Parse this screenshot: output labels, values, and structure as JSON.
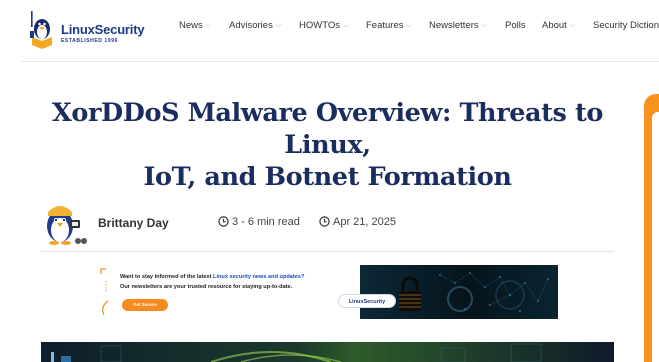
{
  "logo": {
    "name": "LinuxSecurity",
    "tagline": "ESTABLISHED 1996"
  },
  "nav": {
    "items": [
      {
        "label": "News",
        "dropdown": true
      },
      {
        "label": "Advisories",
        "dropdown": true
      },
      {
        "label": "HOWTOs",
        "dropdown": true
      },
      {
        "label": "Features",
        "dropdown": true
      },
      {
        "label": "Newsletters",
        "dropdown": true
      },
      {
        "label": "Polls",
        "dropdown": false
      },
      {
        "label": "About",
        "dropdown": true
      },
      {
        "label": "Security Dictiona",
        "dropdown": false
      }
    ]
  },
  "article": {
    "title_line1": "XorDDoS Malware Overview: Threats to Linux,",
    "title_line2": "IoT, and Botnet Formation",
    "author": "Brittany Day",
    "read_time": "3 - 6 min read",
    "date": "Apr 21, 2025"
  },
  "banner": {
    "line1_prefix": "Want to stay informed of the latest ",
    "line1_highlight": "Linux security news and updates?",
    "line2": "Our newsletters are your trusted resource for staying up-to-date.",
    "button": "Get Secure",
    "logo": "LinuxSecurity"
  },
  "colors": {
    "accent": "#f7931e",
    "title": "#1b2c5f",
    "brand": "#1d3a8a"
  }
}
